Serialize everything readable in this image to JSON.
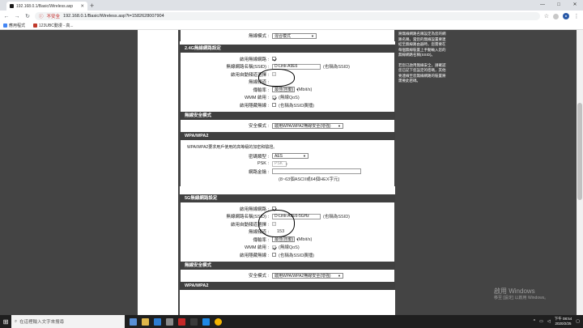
{
  "browser": {
    "tab_title": "192.168.0.1/Basic/Wireless.asp",
    "new_tab": "+",
    "window_controls": [
      "—",
      "□",
      "✕"
    ],
    "security_label": "不安全",
    "url": "192.168.0.1/Basic/Wireless.asp?t=1582628007904",
    "bookmarks": [
      {
        "label": "應用程式",
        "color": "#4285f4"
      },
      {
        "label": "123UBC動漫 - 高...",
        "color": "#c0392b"
      }
    ]
  },
  "top_row": {
    "label": "無線模式 :",
    "value": "混合模式"
  },
  "band24": {
    "header": "2.4G無線網路設定",
    "enable_label": "啟用無線網路 :",
    "ssid_label": "無線網路名稱(SSID) :",
    "ssid_value": "D-Link-A9E6",
    "ssid_note": "(也稱為SSID)",
    "auto_channel_label": "啟用自動頻道選擇 :",
    "channel_label": "無線頻道 :",
    "rate_label": "傳輸率 :",
    "rate_value": "最佳(自動)",
    "rate_unit": "(Mbit/s)",
    "wmm_label": "WMM 啟用 :",
    "wmm_note": "(無線QoS)",
    "hidden_label": "啟用隱藏無線 :",
    "hidden_note": "(也稱為SSID廣播)"
  },
  "security1": {
    "header": "無線安全模式",
    "mode_label": "安全模式 :",
    "mode_value": "啟用WPA/WPA2無線安全(增強)"
  },
  "wpa": {
    "header": "WPA/WPA2",
    "desc": "WPA/WPA2要求用戶使用的高等級的加密和驗證。",
    "cipher_label": "密碼類型 :",
    "cipher_value": "AES",
    "psk_label": "PSK :",
    "psk_value": "PSK",
    "key_label": "網路金鑰 :",
    "key_note": "(8~63個ASCII或64個HEX字元)"
  },
  "band5": {
    "header": "5G無線網路設定",
    "enable_label": "啟用無線網路 :",
    "ssid_label": "無線網路名稱(SSID) :",
    "ssid_value": "D-Link-A9E6-5GHz",
    "ssid_note": "(也稱為SSID)",
    "auto_channel_label": "啟用自動頻道選擇 :",
    "channel_label": "無線頻道 :",
    "channel_value": "153",
    "rate_label": "傳輸率 :",
    "rate_value": "最佳(自動)",
    "rate_unit": "(Mbit/s)",
    "wmm_label": "WMM 啟用 :",
    "wmm_note": "(無線QoS)",
    "hidden_label": "啟用隱藏無線 :",
    "hidden_note": "(也稱為SSID廣播)"
  },
  "security2": {
    "header": "無線安全模式",
    "mode_label": "安全模式 :",
    "mode_value": "啟用WPA/WPA2無線安全(增強)"
  },
  "wpa2_header": "WPA/WPA2",
  "help": {
    "p1": "將無線網路名稱設定為您的網路名稱，當您的無線設置要連結至無線路由器時，您需要在每個無線裝置上手動輸入您的無線網路名稱(SSID)。",
    "p2": "若您已啟用無線安全，請確認您已記下您設定的密碼，其他要連線至您無線網路的裝置將需要此密碼。"
  },
  "watermark": {
    "title": "啟用 Windows",
    "sub": "移至 [設定] 以啟用 Windows。"
  },
  "taskbar": {
    "search_placeholder": "在這裡輸入文字來搜尋",
    "time": "下午 08:54",
    "date": "2020/2/25",
    "apps": [
      "#5a8fd6",
      "#e0b64a",
      "#2d7dd2",
      "#8a8a8a",
      "#c62828",
      "#3a3a3a",
      "#1e88e5",
      "#f4b400"
    ]
  }
}
